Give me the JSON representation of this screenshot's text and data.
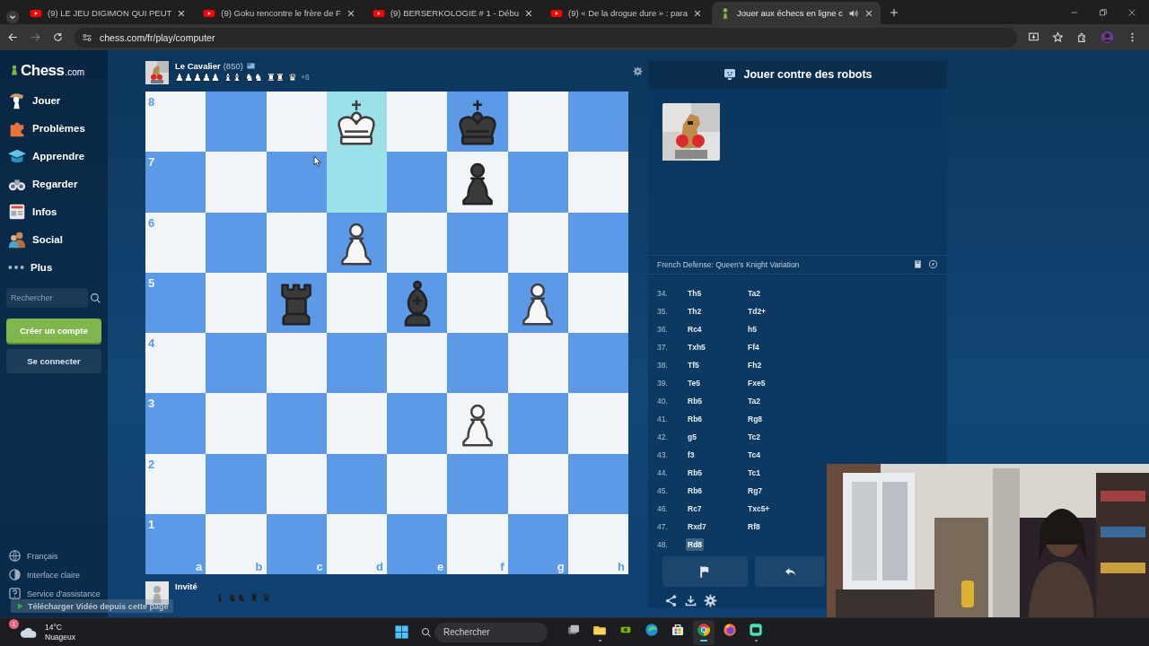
{
  "browser": {
    "tabs": [
      {
        "title": "(9) LE JEU DIGIMON QUI PEUT",
        "kind": "video",
        "selected": false
      },
      {
        "title": "(9) Goku rencontre le frère de F",
        "kind": "video",
        "selected": false
      },
      {
        "title": "(9) BERSERKOLOGIE # 1 - Débu",
        "kind": "video",
        "selected": false
      },
      {
        "title": "(9) « De la drogue dure » : para",
        "kind": "video",
        "selected": false
      },
      {
        "title": "Jouer aux échecs en ligne c",
        "kind": "chess",
        "selected": true,
        "audible": true
      }
    ],
    "url": "chess.com/fr/play/computer"
  },
  "sidebar": {
    "logo": "Chess",
    "logo_suffix": ".com",
    "items": [
      {
        "label": "Jouer"
      },
      {
        "label": "Problèmes"
      },
      {
        "label": "Apprendre"
      },
      {
        "label": "Regarder"
      },
      {
        "label": "Infos"
      },
      {
        "label": "Social"
      },
      {
        "label": "Plus"
      }
    ],
    "search": {
      "placeholder": "Rechercher"
    },
    "buttons": [
      {
        "label": "Créer un compte",
        "kind": "primary"
      },
      {
        "label": "Se connecter",
        "kind": "secondary"
      }
    ],
    "footer": [
      {
        "label": "Français"
      },
      {
        "label": "Interface claire"
      },
      {
        "label": "Service d'assistance"
      }
    ]
  },
  "game": {
    "top_player": {
      "name": "Le Cavalier",
      "rating": "(850)",
      "captured": [
        "♟♟♟♟♟",
        "♝♝",
        "♞♞",
        "♜♜",
        "♛"
      ],
      "captured_white": true,
      "advantage": "+6"
    },
    "board": {
      "ranks": [
        "8",
        "7",
        "6",
        "5",
        "4",
        "3",
        "2",
        "1"
      ],
      "files": [
        "a",
        "b",
        "c",
        "d",
        "e",
        "f",
        "g",
        "h"
      ],
      "rows": [
        [
          {
            "highlighted": false
          },
          {
            "highlighted": false
          },
          {
            "highlighted": false
          },
          {
            "highlighted": true,
            "kind": "king",
            "white": true
          },
          {
            "highlighted": false
          },
          {
            "highlighted": false,
            "kind": "king",
            "white": false
          },
          {
            "highlighted": false
          },
          {
            "highlighted": false
          }
        ],
        [
          {
            "highlighted": false
          },
          {
            "highlighted": false
          },
          {
            "highlighted": false
          },
          {
            "highlighted": true
          },
          {
            "highlighted": false
          },
          {
            "highlighted": false,
            "kind": "pawn",
            "white": false
          },
          {
            "highlighted": false
          },
          {
            "highlighted": false
          }
        ],
        [
          {
            "highlighted": false
          },
          {
            "highlighted": false
          },
          {
            "highlighted": false
          },
          {
            "highlighted": false,
            "kind": "pawn",
            "white": true
          },
          {
            "highlighted": false
          },
          {
            "highlighted": false
          },
          {
            "highlighted": false
          },
          {
            "highlighted": false
          }
        ],
        [
          {
            "highlighted": false
          },
          {
            "highlighted": false
          },
          {
            "highlighted": false,
            "kind": "rook",
            "white": false
          },
          {
            "highlighted": false
          },
          {
            "highlighted": false,
            "kind": "bishop",
            "white": false
          },
          {
            "highlighted": false
          },
          {
            "highlighted": false,
            "kind": "pawn",
            "white": true
          },
          {
            "highlighted": false
          }
        ],
        [
          {
            "highlighted": false
          },
          {
            "highlighted": false
          },
          {
            "highlighted": false
          },
          {
            "highlighted": false
          },
          {
            "highlighted": false
          },
          {
            "highlighted": false
          },
          {
            "highlighted": false
          },
          {
            "highlighted": false
          }
        ],
        [
          {
            "highlighted": false
          },
          {
            "highlighted": false
          },
          {
            "highlighted": false
          },
          {
            "highlighted": false
          },
          {
            "highlighted": false
          },
          {
            "highlighted": false,
            "kind": "pawn",
            "white": true
          },
          {
            "highlighted": false
          },
          {
            "highlighted": false
          }
        ],
        [
          {
            "highlighted": false
          },
          {
            "highlighted": false
          },
          {
            "highlighted": false
          },
          {
            "highlighted": false
          },
          {
            "highlighted": false
          },
          {
            "highlighted": false
          },
          {
            "highlighted": false
          },
          {
            "highlighted": false
          }
        ],
        [
          {
            "highlighted": false
          },
          {
            "highlighted": false
          },
          {
            "highlighted": false
          },
          {
            "highlighted": false
          },
          {
            "highlighted": false
          },
          {
            "highlighted": false
          },
          {
            "highlighted": false
          },
          {
            "highlighted": false
          }
        ]
      ]
    },
    "bottom_player": {
      "name": "Invité",
      "captured": [
        "♝",
        "♞♞",
        "♜",
        "♛"
      ],
      "captured_white": false
    }
  },
  "panel": {
    "title": "Jouer contre des robots",
    "opening": "French Defense: Queen's Knight Variation",
    "moves": [
      {
        "number": "34.",
        "white": {
          "san": "Th5",
          "selected": false
        },
        "black": {
          "san": "Ta2",
          "selected": false
        }
      },
      {
        "number": "35.",
        "white": {
          "san": "Th2",
          "selected": false
        },
        "black": {
          "san": "Td2+",
          "selected": false
        }
      },
      {
        "number": "36.",
        "white": {
          "san": "Rc4",
          "selected": false
        },
        "black": {
          "san": "h5",
          "selected": false
        }
      },
      {
        "number": "37.",
        "white": {
          "san": "Txh5",
          "selected": false
        },
        "black": {
          "san": "Ff4",
          "selected": false
        }
      },
      {
        "number": "38.",
        "white": {
          "san": "Tf5",
          "selected": false
        },
        "black": {
          "san": "Fh2",
          "selected": false
        }
      },
      {
        "number": "39.",
        "white": {
          "san": "Te5",
          "selected": false
        },
        "black": {
          "san": "Fxe5",
          "selected": false
        }
      },
      {
        "number": "40.",
        "white": {
          "san": "Rb5",
          "selected": false
        },
        "black": {
          "san": "Ta2",
          "selected": false
        }
      },
      {
        "number": "41.",
        "white": {
          "san": "Rb6",
          "selected": false
        },
        "black": {
          "san": "Rg8",
          "selected": false
        }
      },
      {
        "number": "42.",
        "white": {
          "san": "g5",
          "selected": false
        },
        "black": {
          "san": "Tc2",
          "selected": false
        }
      },
      {
        "number": "43.",
        "white": {
          "san": "f3",
          "selected": false
        },
        "black": {
          "san": "Tc4",
          "selected": false
        }
      },
      {
        "number": "44.",
        "white": {
          "san": "Rb5",
          "selected": false
        },
        "black": {
          "san": "Tc1",
          "selected": false
        }
      },
      {
        "number": "45.",
        "white": {
          "san": "Rb6",
          "selected": false
        },
        "black": {
          "san": "Rg7",
          "selected": false
        }
      },
      {
        "number": "46.",
        "white": {
          "san": "Rc7",
          "selected": false
        },
        "black": {
          "san": "Txc5+",
          "selected": false
        }
      },
      {
        "number": "47.",
        "white": {
          "san": "Rxd7",
          "selected": false
        },
        "black": {
          "san": "Rf8",
          "selected": false
        }
      },
      {
        "number": "48.",
        "white": {
          "san": "Rd8",
          "selected": true
        }
      }
    ]
  },
  "download_bar": {
    "label": "Télécharger Vidéo depuis cette page"
  },
  "taskbar": {
    "weather": {
      "temperature": "14°C",
      "condition": "Nuageux",
      "badge": "1"
    },
    "search": {
      "placeholder": "Rechercher"
    },
    "apps": [
      {
        "kind": "taskview",
        "running": false,
        "active": false
      },
      {
        "kind": "files",
        "running": true,
        "active": false
      },
      {
        "kind": "gpu",
        "running": false,
        "active": false
      },
      {
        "kind": "edge",
        "running": false,
        "active": false
      },
      {
        "kind": "store",
        "running": false,
        "active": false
      },
      {
        "kind": "chrome",
        "running": true,
        "active": true
      },
      {
        "kind": "firefox",
        "running": false,
        "active": false
      },
      {
        "kind": "app",
        "running": true,
        "active": false
      }
    ]
  }
}
